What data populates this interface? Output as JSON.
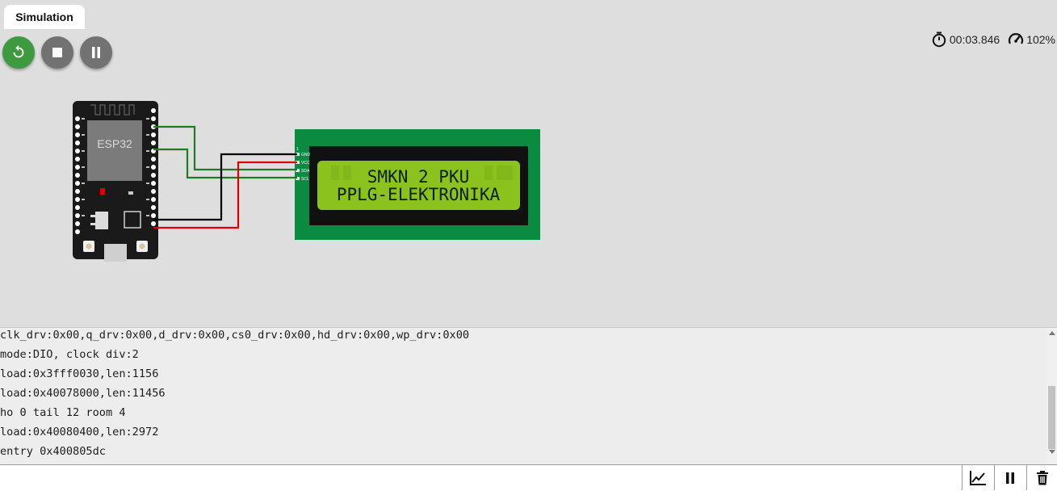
{
  "tabs": {
    "active_label": "Simulation"
  },
  "controls": {
    "restart": {
      "icon": "restart-icon",
      "color": "#3d9a3f"
    },
    "stop": {
      "icon": "stop-icon",
      "color": "#727272"
    },
    "pause": {
      "icon": "pause-icon",
      "color": "#727272"
    }
  },
  "status": {
    "elapsed_time": "00:03.846",
    "speed": "102%",
    "timer_icon": "stopwatch-icon",
    "speed_icon": "speedometer-icon"
  },
  "circuit": {
    "board_label": "ESP32",
    "lcd": {
      "line1": "SMKN 2 PKU",
      "line2": "PPLG-ELEKTRONIKA",
      "backlight_color": "#8bc21d",
      "pcb_color": "#0b8a42"
    },
    "wire_colors": {
      "gnd": "#000000",
      "vcc": "#e00000",
      "sda": "#1e7d1e",
      "scl": "#1e7d1e"
    }
  },
  "serial_monitor": {
    "lines": [
      "clk_drv:0x00,q_drv:0x00,d_drv:0x00,cs0_drv:0x00,hd_drv:0x00,wp_drv:0x00",
      "mode:DIO, clock div:2",
      "load:0x3fff0030,len:1156",
      "load:0x40078000,len:11456",
      "ho 0 tail 12 room 4",
      "load:0x40080400,len:2972",
      "entry 0x400805dc"
    ],
    "input_value": "",
    "buttons": {
      "chart": "chart-icon",
      "pause": "pause-icon",
      "clear": "trash-icon"
    }
  }
}
